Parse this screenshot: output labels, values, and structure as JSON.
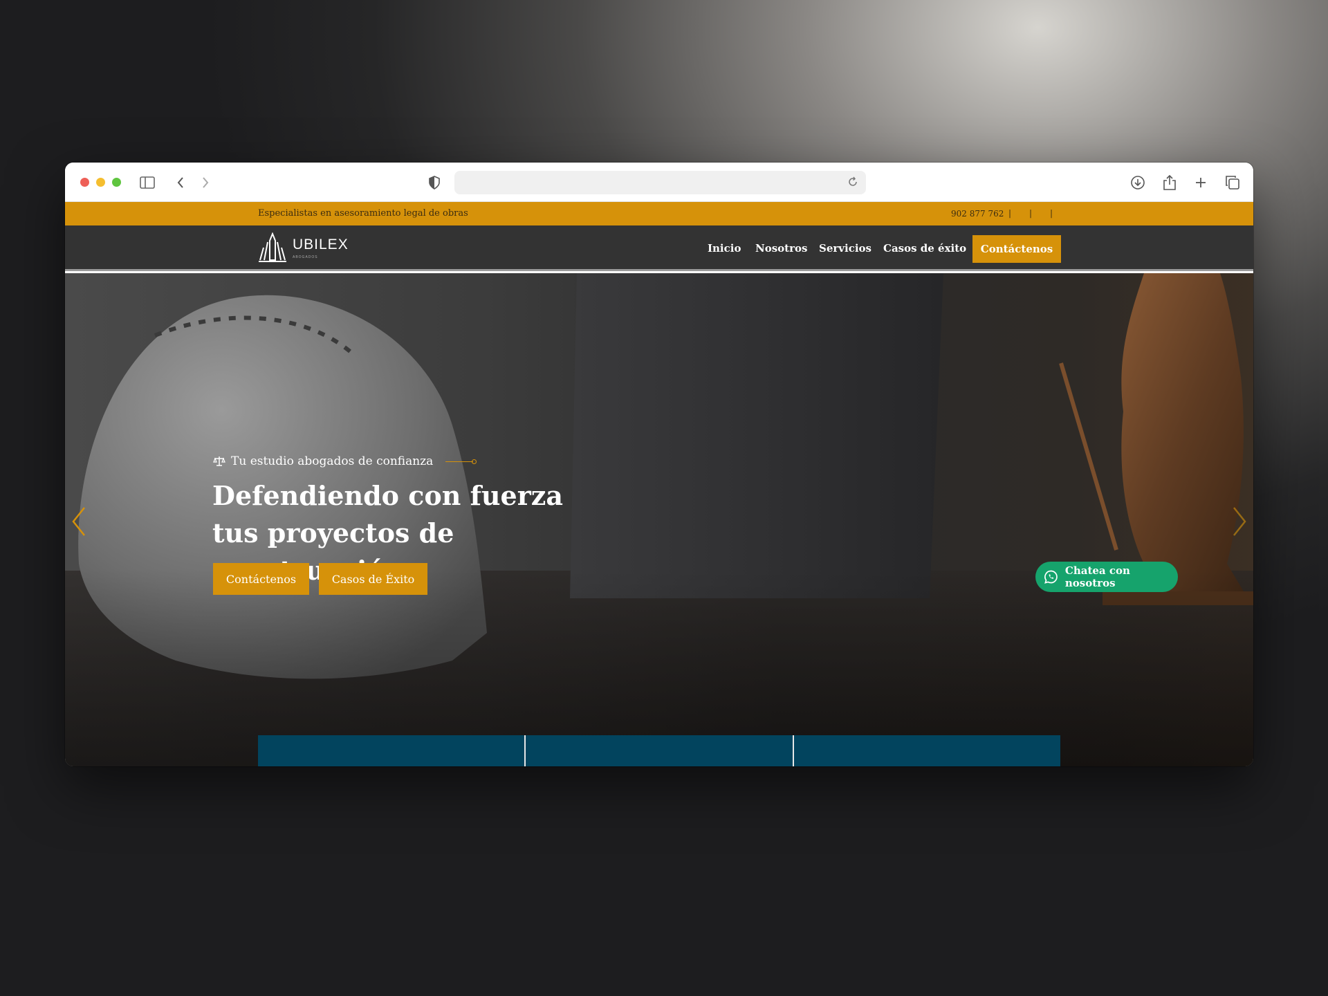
{
  "browser": {
    "address_value": ""
  },
  "topbar": {
    "tagline": "Especialistas en asesoramiento legal de obras",
    "phone": "902 877 762",
    "separator": "|"
  },
  "brand": {
    "name": "UBILEX",
    "subtitle": "ABOGADOS"
  },
  "nav": {
    "items": [
      "Inicio",
      "Nosotros",
      "Servicios",
      "Casos de éxito"
    ],
    "cta": "Contáctenos"
  },
  "hero": {
    "eyebrow": "Tu estudio abogados de confianza",
    "title": "Defendiendo con fuerza tus proyectos de construcción",
    "buttons": [
      "Contáctenos",
      "Casos de Éxito"
    ]
  },
  "whatsapp": {
    "label": "Chatea con nosotros"
  },
  "colors": {
    "accent": "#d6920a",
    "navbar": "#333333",
    "tabs": "#02445e",
    "whatsapp": "#16a36c"
  }
}
